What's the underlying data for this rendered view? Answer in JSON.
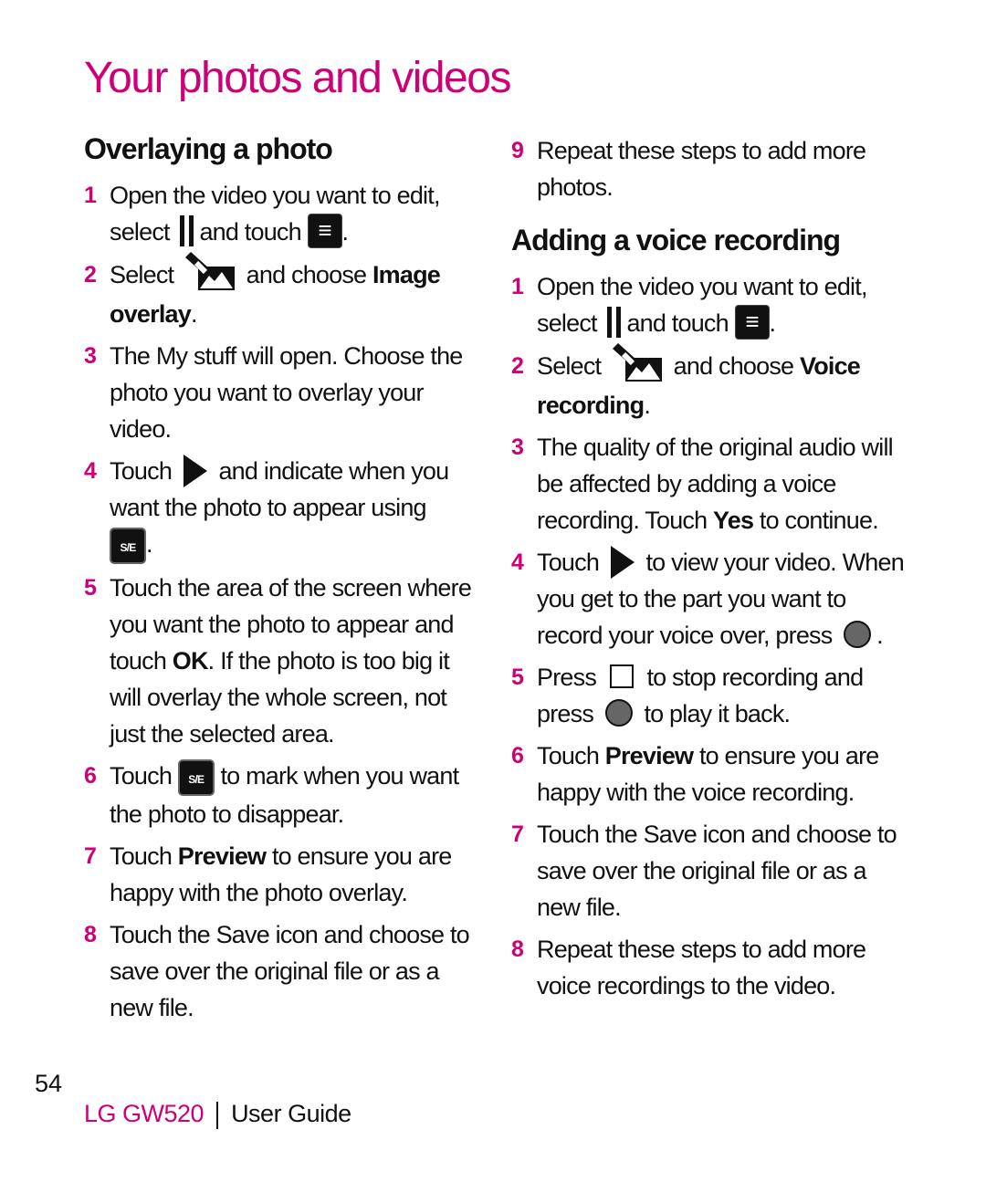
{
  "page_title": "Your photos and videos",
  "left": {
    "heading": "Overlaying a photo",
    "steps": [
      {
        "num": "1",
        "a": "Open the video you want to edit, select",
        "b": "and touch",
        "c": "."
      },
      {
        "num": "2",
        "a": "Select",
        "b": "and choose",
        "bold": "Image overlay",
        "c": "."
      },
      {
        "num": "3",
        "a": "The My stuff will open. Choose the photo you want to overlay your video."
      },
      {
        "num": "4",
        "a": "Touch",
        "b": "and indicate when you want the photo to appear using",
        "c": "."
      },
      {
        "num": "5",
        "a": "Touch the area of the screen where you want the photo to appear and touch",
        "bold": "OK",
        "c": ". If the photo is too big it will overlay the whole screen, not just the selected area."
      },
      {
        "num": "6",
        "a": "Touch",
        "b": "to mark when you want the photo to disappear."
      },
      {
        "num": "7",
        "a": "Touch",
        "bold": "Preview",
        "c": "to ensure you are happy with the photo overlay."
      },
      {
        "num": "8",
        "a": "Touch the Save icon and choose to save over the original file or as a new file."
      }
    ]
  },
  "right": {
    "step9": {
      "num": "9",
      "a": "Repeat these steps to add more photos."
    },
    "heading": "Adding a voice recording",
    "steps": [
      {
        "num": "1",
        "a": "Open the video you want to edit, select",
        "b": "and touch",
        "c": "."
      },
      {
        "num": "2",
        "a": "Select",
        "b": "and choose",
        "bold": "Voice recording",
        "c": "."
      },
      {
        "num": "3",
        "a": "The quality of the original audio will be affected by adding a voice recording. Touch",
        "bold": "Yes",
        "c": "to continue."
      },
      {
        "num": "4",
        "a": "Touch",
        "b": "to view your video. When you get to the part you want to record your voice over, press",
        "c": "."
      },
      {
        "num": "5",
        "a": "Press",
        "b": "to stop recording and press",
        "c": "to play it back."
      },
      {
        "num": "6",
        "a": "Touch",
        "bold": "Preview",
        "c": "to ensure you are happy with the voice recording."
      },
      {
        "num": "7",
        "a": "Touch the Save icon and choose to save over the original file or as a new file."
      },
      {
        "num": "8",
        "a": "Repeat these steps to add more voice recordings to the video."
      }
    ]
  },
  "icons": {
    "pause": "pause-icon",
    "menu": "menu-icon",
    "edit": "edit-image-icon",
    "play": "play-icon",
    "se": "S/E",
    "record": "record-icon",
    "stop": "stop-icon"
  },
  "footer": {
    "page_number": "54",
    "model": "LG GW520",
    "guide": "User Guide"
  },
  "colors": {
    "accent": "#cc0077"
  }
}
